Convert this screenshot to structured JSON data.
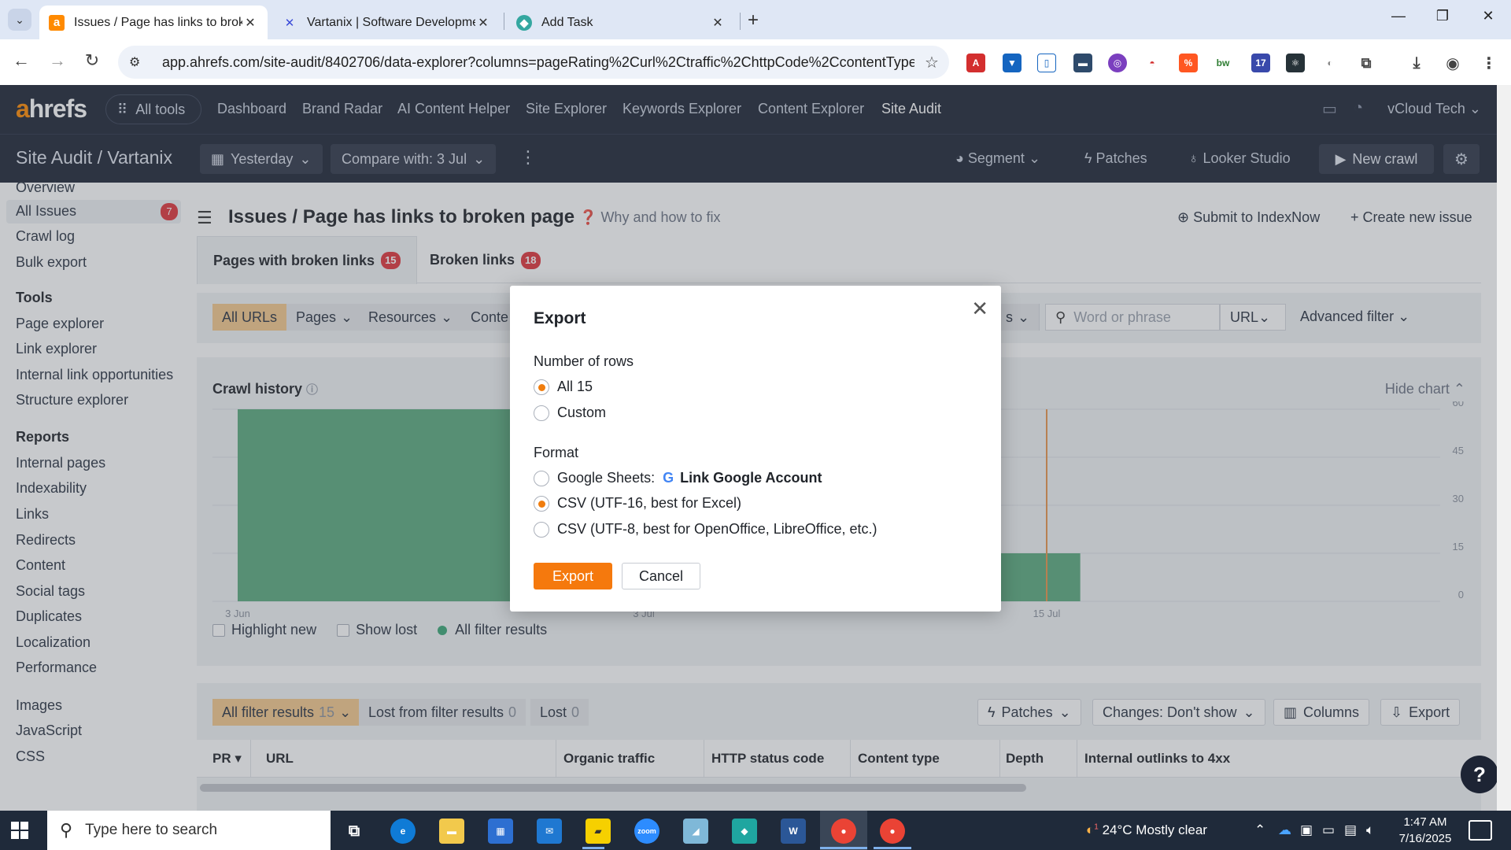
{
  "browser": {
    "tabs": [
      {
        "title": "Issues / Page has links to broken page",
        "active": true
      },
      {
        "title": "Vartanix | Software Development",
        "active": false
      },
      {
        "title": "Add Task",
        "active": false
      }
    ],
    "url": "app.ahrefs.com/site-audit/8402706/data-explorer?columns=pageRating%2Curl%2Ctraffic%2ChttpCode%2CcontentType%...",
    "extension_badge": "17"
  },
  "app": {
    "logo": {
      "a": "a",
      "rest": "hrefs"
    },
    "all_tools": "All tools",
    "nav": [
      "Dashboard",
      "Brand Radar",
      "AI Content Helper",
      "Site Explorer",
      "Keywords Explorer",
      "Content Explorer",
      "Site Audit"
    ],
    "account": "vCloud Tech",
    "subnav": {
      "breadcrumb": "Site Audit / Vartanix",
      "date": "Yesterday",
      "compare": "Compare with: 3 Jul",
      "segment": "Segment",
      "patches": "Patches",
      "looker": "Looker Studio",
      "new_crawl": "New crawl"
    }
  },
  "sidebar": {
    "top": [
      {
        "label": "Overview"
      },
      {
        "label": "All Issues",
        "badge": "7"
      },
      {
        "label": "Crawl log"
      },
      {
        "label": "Bulk export"
      }
    ],
    "tools_heading": "Tools",
    "tools": [
      "Page explorer",
      "Link explorer",
      "Internal link opportunities",
      "Structure explorer"
    ],
    "reports_heading": "Reports",
    "reports": [
      "Internal pages",
      "Indexability",
      "Links",
      "Redirects",
      "Content",
      "Social tags",
      "Duplicates",
      "Localization",
      "Performance"
    ],
    "other": [
      "Images",
      "JavaScript",
      "CSS"
    ]
  },
  "main": {
    "breadcrumb": "Issues / Page has links to broken page",
    "why": "Why and how to fix",
    "submit": "Submit to IndexNow",
    "create_issue": "Create new issue",
    "tabs": [
      {
        "label": "Pages with broken links",
        "count": "15"
      },
      {
        "label": "Broken links",
        "count": "18"
      }
    ],
    "filters": {
      "all_urls": "All URLs",
      "pages": "Pages",
      "resources": "Resources",
      "content": "Conte",
      "partial": "s",
      "search_placeholder": "Word or phrase",
      "url": "URL",
      "advanced": "Advanced filter"
    },
    "chart": {
      "title": "Crawl history",
      "hide": "Hide chart",
      "highlight": "Highlight new",
      "show_lost": "Show lost",
      "all_results": "All filter results"
    },
    "table": {
      "all_results": "All filter results",
      "all_count": "15",
      "lost_from": "Lost from filter results",
      "lost_from_count": "0",
      "lost": "Lost",
      "lost_count": "0",
      "patches": "Patches",
      "changes": "Changes: Don't show",
      "columns": "Columns",
      "export": "Export",
      "headers": [
        "PR",
        "URL",
        "Organic traffic",
        "HTTP status code",
        "Content type",
        "Depth",
        "Internal outlinks to 4xx"
      ]
    }
  },
  "chart_data": {
    "type": "bar",
    "title": "Crawl history",
    "x_ticks": [
      "3 Jun",
      "3 Jul",
      "15 Jul"
    ],
    "y_ticks": [
      0,
      15,
      30,
      45,
      60
    ],
    "ylim": [
      0,
      60
    ],
    "series": [
      {
        "name": "All filter results",
        "segments": [
          {
            "from": "3 Jun",
            "to": "3 Jul",
            "value": 60
          },
          {
            "from": "8 Jul",
            "to": "16 Jul",
            "value": 15
          }
        ]
      }
    ],
    "marker": "15 Jul",
    "color": "#5aaa7e",
    "grid": true
  },
  "modal": {
    "title": "Export",
    "rows_label": "Number of rows",
    "rows_options": [
      {
        "label": "All 15",
        "selected": true
      },
      {
        "label": "Custom",
        "selected": false
      }
    ],
    "format_label": "Format",
    "google_sheets": "Google Sheets:",
    "link_google": "Link Google Account",
    "csv16": "CSV (UTF-16, best for Excel)",
    "csv8": "CSV (UTF-8, best for OpenOffice, LibreOffice, etc.)",
    "export_btn": "Export",
    "cancel_btn": "Cancel"
  },
  "taskbar": {
    "search_placeholder": "Type here to search",
    "weather": "24°C  Mostly clear",
    "weather_badge": "1",
    "time": "1:47 AM",
    "date": "7/16/2025"
  }
}
